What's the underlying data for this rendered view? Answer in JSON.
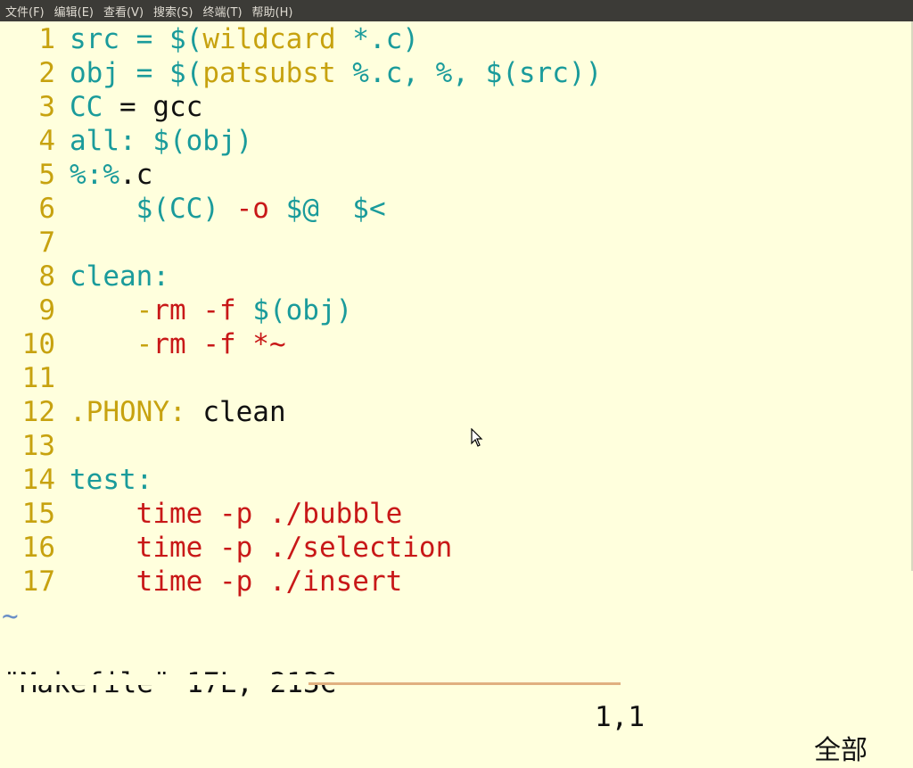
{
  "menubar": {
    "items": [
      "文件(F)",
      "编辑(E)",
      "查看(V)",
      "搜索(S)",
      "终端(T)",
      "帮助(H)"
    ]
  },
  "editor": {
    "lines": [
      {
        "num": "1",
        "segments": [
          {
            "t": "src = ",
            "c": "teal"
          },
          {
            "t": "$(",
            "c": "teal"
          },
          {
            "t": "wildcard ",
            "c": "olive"
          },
          {
            "t": "*.c)",
            "c": "teal"
          }
        ]
      },
      {
        "num": "2",
        "segments": [
          {
            "t": "obj = ",
            "c": "teal"
          },
          {
            "t": "$(",
            "c": "teal"
          },
          {
            "t": "patsubst ",
            "c": "olive"
          },
          {
            "t": "%.c, %, $(src))",
            "c": "teal"
          }
        ]
      },
      {
        "num": "3",
        "segments": [
          {
            "t": "CC",
            "c": "teal"
          },
          {
            "t": " = gcc",
            "c": "black"
          }
        ]
      },
      {
        "num": "4",
        "segments": [
          {
            "t": "all: $(obj)",
            "c": "teal"
          }
        ]
      },
      {
        "num": "5",
        "segments": [
          {
            "t": "%:%",
            "c": "teal"
          },
          {
            "t": ".c",
            "c": "black"
          }
        ]
      },
      {
        "num": "6",
        "segments": [
          {
            "t": "    $(CC) ",
            "c": "teal"
          },
          {
            "t": "-o ",
            "c": "red"
          },
          {
            "t": "$@  $<",
            "c": "teal"
          }
        ]
      },
      {
        "num": "7",
        "segments": []
      },
      {
        "num": "8",
        "segments": [
          {
            "t": "clean:",
            "c": "teal"
          }
        ]
      },
      {
        "num": "9",
        "segments": [
          {
            "t": "    -",
            "c": "olive"
          },
          {
            "t": "rm -f ",
            "c": "red"
          },
          {
            "t": "$(obj)",
            "c": "teal"
          }
        ]
      },
      {
        "num": "10",
        "segments": [
          {
            "t": "    -",
            "c": "olive"
          },
          {
            "t": "rm -f *~",
            "c": "red"
          }
        ]
      },
      {
        "num": "11",
        "segments": []
      },
      {
        "num": "12",
        "segments": [
          {
            "t": ".PHONY:",
            "c": "olive"
          },
          {
            "t": " clean",
            "c": "black"
          }
        ]
      },
      {
        "num": "13",
        "segments": []
      },
      {
        "num": "14",
        "segments": [
          {
            "t": "test:",
            "c": "teal"
          }
        ]
      },
      {
        "num": "15",
        "segments": [
          {
            "t": "    time -p ./bubble",
            "c": "red"
          }
        ]
      },
      {
        "num": "16",
        "segments": [
          {
            "t": "    time -p ./selection",
            "c": "red"
          }
        ]
      },
      {
        "num": "17",
        "segments": [
          {
            "t": "    time -p ./insert",
            "c": "red"
          }
        ]
      }
    ],
    "tilde": "~"
  },
  "status": {
    "file": "\"Makefile\" 17L, 213C",
    "position": "1,1",
    "scroll": "全部"
  },
  "colors": {
    "background": "#ffffdd",
    "teal": "#1a9b9b",
    "red": "#c81818",
    "olive": "#c7a20f",
    "black": "#111111"
  }
}
